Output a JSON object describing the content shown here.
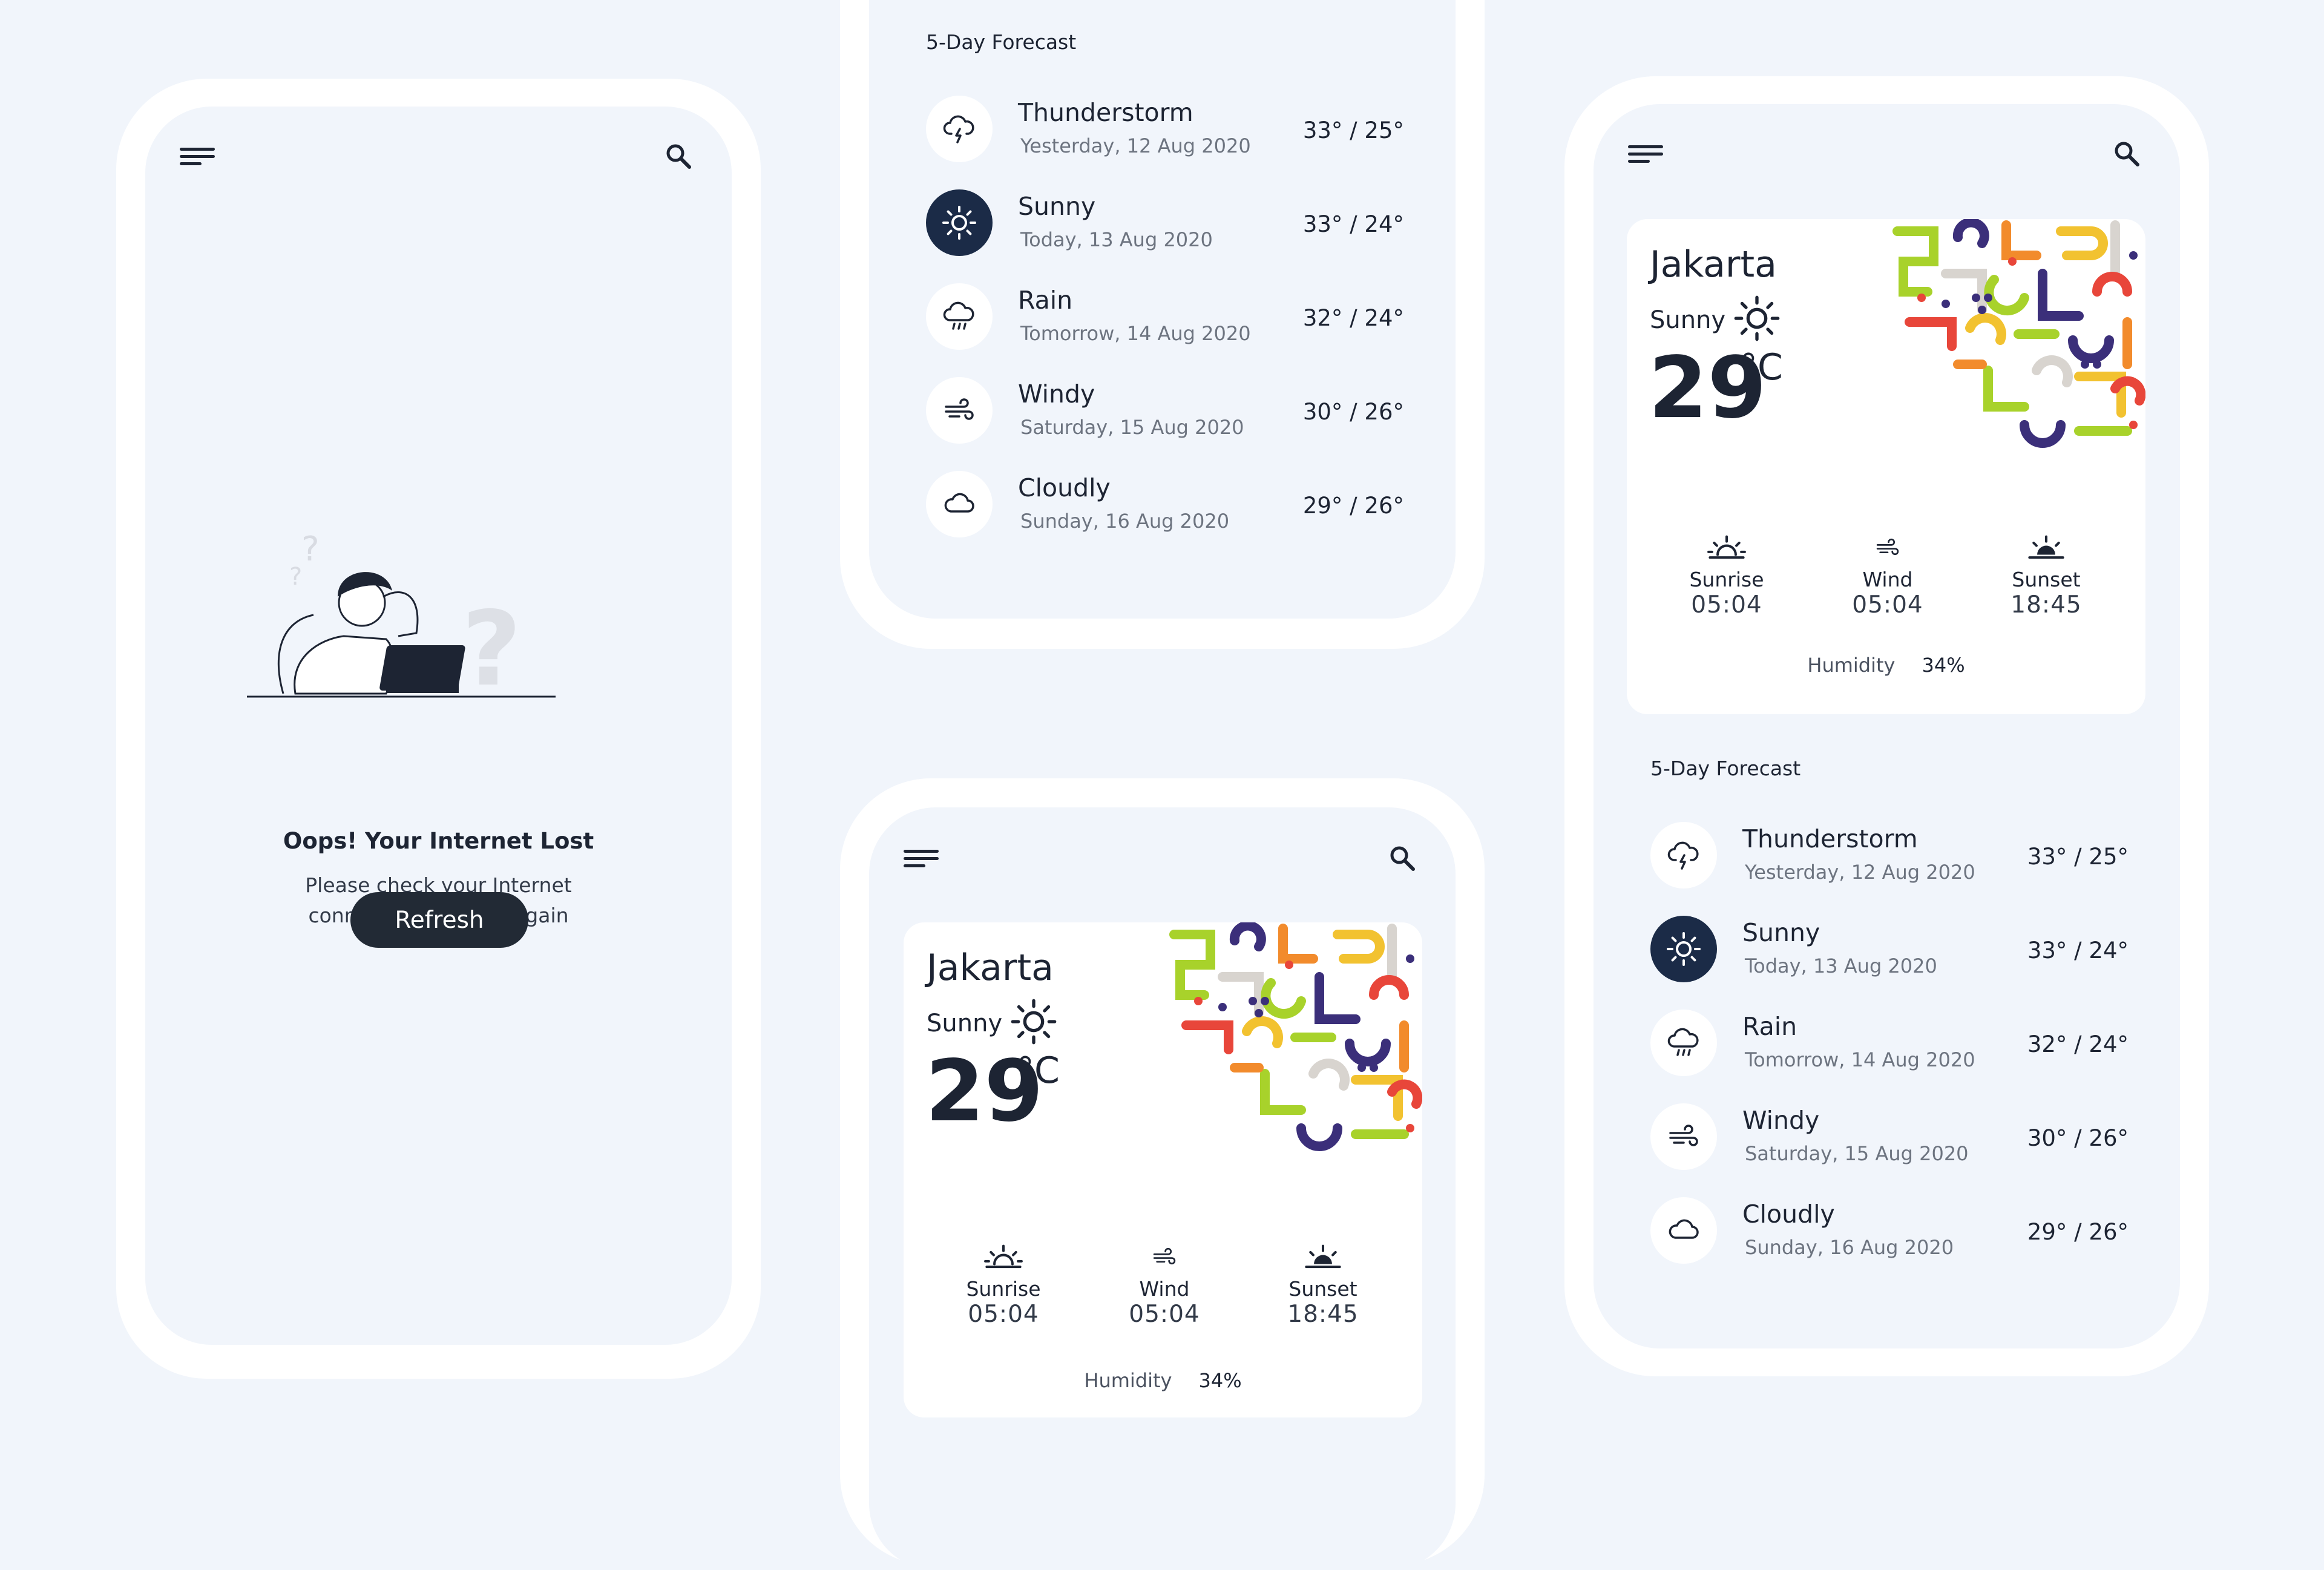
{
  "colors": {
    "background": "#f1f5fb",
    "frame": "#ffffff",
    "dark": "#1d2433",
    "active_icon_bg": "#1b2b47",
    "button_bg": "#222a35",
    "pattern": [
      "#a8d22b",
      "#3b2f7a",
      "#f28b2c",
      "#f2c230",
      "#d8d4cf",
      "#e8463a"
    ]
  },
  "icons": [
    "menu-icon",
    "search-icon",
    "thunderstorm-icon",
    "sun-icon",
    "rain-icon",
    "wind-icon",
    "cloud-icon",
    "sunrise-icon",
    "sunset-icon"
  ],
  "offline": {
    "title": "Oops! Your Internet Lost",
    "message_line1": "Please check your Internet",
    "message_line2": "connections and try again",
    "refresh_label": "Refresh"
  },
  "forecast": {
    "title": "5-Day Forecast",
    "days": [
      {
        "condition": "Thunderstorm",
        "date": "Yesterday, 12 Aug 2020",
        "temp": "33° / 25°",
        "icon": "thunderstorm-icon"
      },
      {
        "condition": "Sunny",
        "date": "Today, 13 Aug 2020",
        "temp": "33° / 24°",
        "icon": "sun-icon",
        "active": true
      },
      {
        "condition": "Rain",
        "date": "Tomorrow, 14 Aug 2020",
        "temp": "32° / 24°",
        "icon": "rain-icon"
      },
      {
        "condition": "Windy",
        "date": "Saturday, 15 Aug 2020",
        "temp": "30° / 26°",
        "icon": "wind-icon"
      },
      {
        "condition": "Cloudly",
        "date": "Sunday, 16 Aug 2020",
        "temp": "29° / 26°",
        "icon": "cloud-icon"
      }
    ]
  },
  "current": {
    "city": "Jakarta",
    "condition": "Sunny",
    "temp": "29",
    "unit": "°C",
    "sunrise_label": "Sunrise",
    "sunrise_value": "05:04",
    "wind_label": "Wind",
    "wind_value": "05:04",
    "sunset_label": "Sunset",
    "sunset_value": "18:45",
    "humidity_label": "Humidity",
    "humidity_value": "34%"
  }
}
